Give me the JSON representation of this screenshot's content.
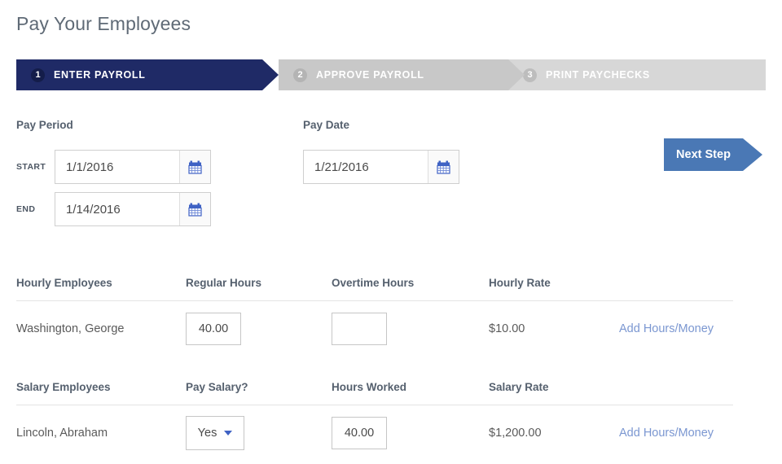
{
  "page": {
    "title": "Pay Your Employees"
  },
  "wizard": {
    "steps": [
      {
        "number": "1",
        "label": "ENTER PAYROLL",
        "state": "active"
      },
      {
        "number": "2",
        "label": "APPROVE PAYROLL",
        "state": "inactive"
      },
      {
        "number": "3",
        "label": "PRINT PAYCHECKS",
        "state": "inactive"
      }
    ]
  },
  "pay_period": {
    "label": "Pay Period",
    "start": {
      "label": "START",
      "value": "1/1/2016",
      "icon": "calendar-icon"
    },
    "end": {
      "label": "END",
      "value": "1/14/2016",
      "icon": "calendar-icon"
    }
  },
  "pay_date": {
    "label": "Pay Date",
    "value": "1/21/2016",
    "icon": "calendar-icon"
  },
  "actions": {
    "next_step": "Next Step"
  },
  "hourly_table": {
    "headers": [
      "Hourly Employees",
      "Regular Hours",
      "Overtime Hours",
      "Hourly Rate",
      ""
    ],
    "rows": [
      {
        "name": "Washington, George",
        "regular_hours": "40.00",
        "overtime_hours": "",
        "hourly_rate": "$10.00",
        "add_link": "Add Hours/Money"
      }
    ]
  },
  "salary_table": {
    "headers": [
      "Salary Employees",
      "Pay Salary?",
      "Hours Worked",
      "Salary Rate",
      ""
    ],
    "rows": [
      {
        "name": "Lincoln, Abraham",
        "pay_salary": "Yes",
        "hours_worked": "40.00",
        "salary_rate": "$1,200.00",
        "add_link": "Add Hours/Money"
      }
    ]
  },
  "colors": {
    "step_active": "#1f2a66",
    "step_inactive": "#c8c8c8",
    "next_button": "#4a78b5",
    "link": "#7b97d1",
    "calendar_icon": "#3f62c4"
  }
}
